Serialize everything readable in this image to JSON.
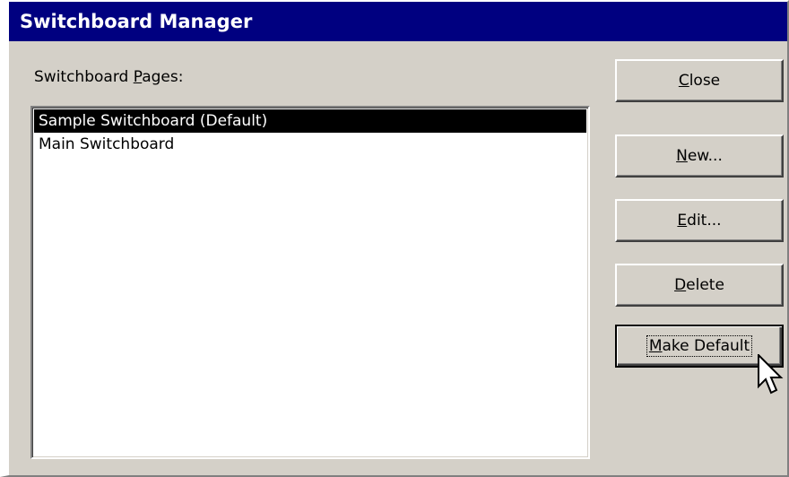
{
  "window": {
    "title": "Switchboard Manager"
  },
  "pages_label": {
    "before": "Switchboard ",
    "mnemonic": "P",
    "after": "ages:"
  },
  "pages": [
    {
      "label": "Sample Switchboard (Default)",
      "selected": true
    },
    {
      "label": "Main Switchboard",
      "selected": false
    }
  ],
  "buttons": {
    "close": {
      "mnemonic": "C",
      "rest": "lose"
    },
    "new": {
      "mnemonic": "N",
      "rest": "ew..."
    },
    "edit": {
      "mnemonic": "E",
      "rest": "dit..."
    },
    "delete": {
      "mnemonic": "D",
      "rest": "elete"
    },
    "make_default": {
      "mnemonic": "M",
      "rest": "ake Default"
    }
  },
  "colors": {
    "title_bar": "#000080",
    "dialog_face": "#d4d0c8",
    "selection": "#000000"
  },
  "cursor": {
    "icon": "arrow-pointer-icon"
  }
}
